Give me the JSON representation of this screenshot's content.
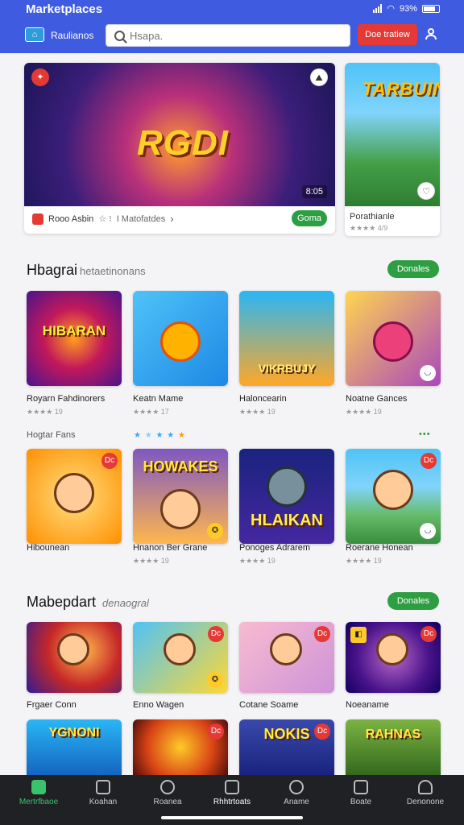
{
  "status_bar": {
    "title": "Marketplaces",
    "battery": "93%"
  },
  "header": {
    "brand": "Raulianos",
    "search_placeholder": "Hsapa.",
    "cta_label": "Doe tratiew"
  },
  "featured": {
    "main": {
      "art_title": "RGDI",
      "name": "Rooo Asbin",
      "sep": "☆ ⁝",
      "publisher": "I Matofatdes",
      "count": "8:05",
      "button": "Goma"
    },
    "side": {
      "art_title": "TARBUIN",
      "name": "Porathianle",
      "rating": "★★★★ 4/9"
    }
  },
  "section1": {
    "title": "Hbagrai",
    "subtitle": "hetaetinonans",
    "button": "Donales",
    "games": [
      {
        "art": "HIBARAN",
        "name": "Royarn Fahdinorers",
        "rating": "★★★★ 19"
      },
      {
        "art": "",
        "name": "Keatn Mame",
        "rating": "★★★★ 17"
      },
      {
        "art": "VIKRBUJY",
        "name": "Haloncearin",
        "rating": "★★★★ 19"
      },
      {
        "art": "",
        "name": "Noatne Gances",
        "rating": "★★★★ 19"
      }
    ],
    "row2_label": "Hogtar Fans",
    "games2": [
      {
        "art": "",
        "name": "Hibounean",
        "rating": ""
      },
      {
        "art": "HOWAKES",
        "name": "Hnanon Ber Grane",
        "rating": "★★★★ 19"
      },
      {
        "art": "HLAIKAN",
        "name": "Ponoges Adrarem",
        "rating": "★★★★ 19"
      },
      {
        "art": "",
        "name": "Roerane Honean",
        "rating": "★★★★ 19"
      }
    ]
  },
  "section2": {
    "title": "Mabepdart",
    "subtitle": "denaogral",
    "button": "Donales",
    "games": [
      {
        "art": "",
        "name": "Frgaer Conn"
      },
      {
        "art": "",
        "name": "Enno Wagen"
      },
      {
        "art": "",
        "name": "Cotane Soame"
      },
      {
        "art": "",
        "name": "Noeaname"
      }
    ],
    "games2": [
      {
        "art": "YGNONI"
      },
      {
        "art": ""
      },
      {
        "art": "NOKIS"
      },
      {
        "art": "RAHNAS"
      }
    ]
  },
  "bottom_nav": [
    {
      "label": "Mertrfbaoe",
      "active": true
    },
    {
      "label": "Koahan"
    },
    {
      "label": "Roanea"
    },
    {
      "label": "Rhhtrtoats"
    },
    {
      "label": "Aname"
    },
    {
      "label": "Boate"
    },
    {
      "label": "Denonone"
    }
  ]
}
